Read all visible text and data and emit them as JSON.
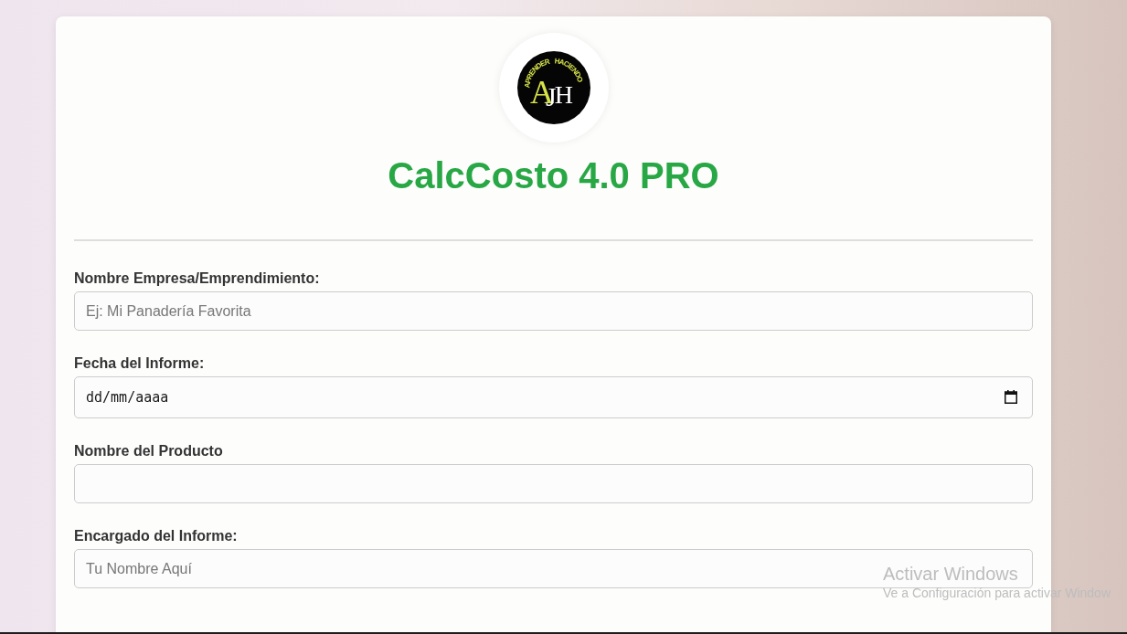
{
  "logo": {
    "monogram": [
      "A",
      "J",
      "H"
    ],
    "tagline": [
      "APRENDER",
      "HACIENDO"
    ]
  },
  "title": "CalcCosto 4.0 PRO",
  "fields": [
    {
      "kind": "text",
      "label": "Nombre Empresa/Emprendimiento:",
      "placeholder": "Ej: Mi Panadería Favorita"
    },
    {
      "kind": "date",
      "label": "Fecha del Informe:",
      "placeholder": "dd/mm/aaaa"
    },
    {
      "kind": "text",
      "label": "Nombre del Producto"
    },
    {
      "kind": "text",
      "label": "Encargado del Informe:",
      "placeholder": "Tu Nombre Aquí"
    }
  ],
  "activation_notice": {
    "title": "Activar Windows",
    "message": "Ve a Configuración para activar Window"
  }
}
